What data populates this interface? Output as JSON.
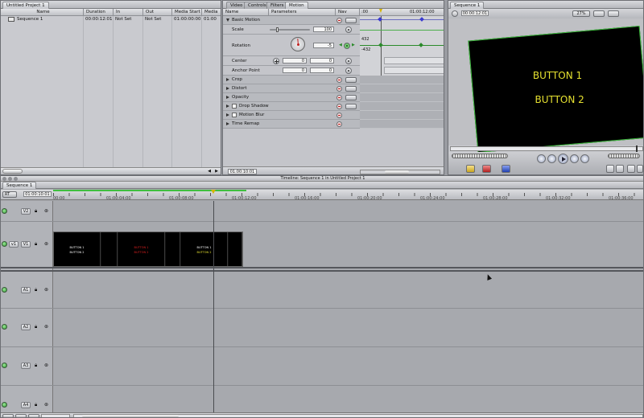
{
  "browser": {
    "tab": "Untitled Project 1",
    "columns": [
      "Name",
      "Duration",
      "In",
      "Out",
      "Media Start",
      "Media E"
    ],
    "rows": [
      {
        "name": "Sequence 1",
        "duration": "00:00:12:01",
        "in": "Not Set",
        "out": "Not Set",
        "media_start": "01:00:00:00",
        "media_end": "01:00"
      }
    ]
  },
  "viewer": {
    "tabs": [
      "Video",
      "Controls",
      "Filters",
      "Motion"
    ],
    "active_tab": "Motion",
    "columns": [
      "Name",
      "Parameters",
      "Nav"
    ],
    "ruler_start": ":00",
    "ruler_end": "01:00:12:00",
    "params": [
      {
        "name": "Basic Motion",
        "value": ""
      },
      {
        "name": "Scale",
        "value": "100"
      },
      {
        "name": "Rotation",
        "value": "-5"
      },
      {
        "name": "Center",
        "value_x": "0",
        "value_y": "0"
      },
      {
        "name": "Anchor Point",
        "value_x": "0",
        "value_y": "0"
      },
      {
        "name": "Crop"
      },
      {
        "name": "Distort"
      },
      {
        "name": "Opacity"
      },
      {
        "name": "Drop Shadow"
      },
      {
        "name": "Motion Blur"
      },
      {
        "name": "Time Remap"
      }
    ],
    "rotation_range_top": "432",
    "rotation_range_bottom": "-432",
    "timecode": "01:00:10:01"
  },
  "canvas": {
    "tab": "Sequence 1",
    "timecode": "00:00:12:01",
    "zoom": "27%",
    "button1": "BUTTON 1",
    "button2": "BUTTON 2"
  },
  "timeline": {
    "title": "Timeline: Sequence 1 in Untitled Project 1",
    "tab": "Sequence 1",
    "rt": "RT",
    "timecode": "01:00:10:01",
    "ruler": [
      "00:00",
      "01:00:04:00",
      "01:00:08:00",
      "01:00:12:00",
      "01:00:16:00",
      "01:00:20:00",
      "01:00:24:00",
      "01:00:28:00",
      "01:00:32:00",
      "01:00:36:00"
    ],
    "tracks": [
      "V2",
      "V1",
      "A1",
      "A2",
      "A3",
      "A4"
    ],
    "src_v": "v1",
    "clip_labels": [
      "BUTTON 1",
      "BUTTON 2"
    ]
  },
  "colors": {
    "accent_green": "#3fbf3f",
    "canvas_text": "#e5e030",
    "clip_red": "#e02020"
  }
}
